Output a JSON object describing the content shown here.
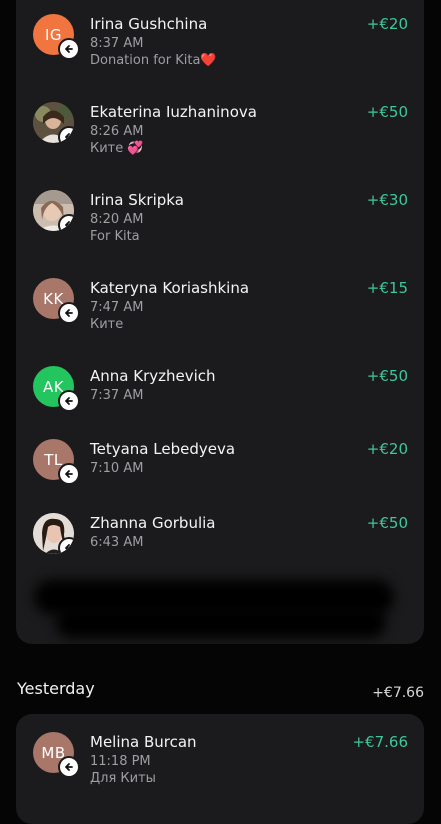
{
  "colors": {
    "background": "#050505",
    "card": "#1b1b1d",
    "income_amount": "#3dc79b",
    "secondary_text": "#9e9ea3"
  },
  "today": {
    "transactions": [
      {
        "name": "Irina Gushchina",
        "time": "8:37 AM",
        "note": "Donation for Kita❤️",
        "amount": "+€20",
        "avatar_initials": "IG",
        "avatar_color": "#f0753f",
        "avatar_type": "initials"
      },
      {
        "name": "Ekaterina Iuzhaninova",
        "time": "8:26 AM",
        "note": "Ките 💞",
        "amount": "+€50",
        "avatar_initials": "",
        "avatar_type": "photo"
      },
      {
        "name": "Irina Skripka",
        "time": "8:20 AM",
        "note": "For Kita",
        "amount": "+€30",
        "avatar_initials": "",
        "avatar_type": "photo"
      },
      {
        "name": "Kateryna Koriashkina",
        "time": "7:47 AM",
        "note": "Ките",
        "amount": "+€15",
        "avatar_initials": "KK",
        "avatar_color": "#a8776a",
        "avatar_type": "initials"
      },
      {
        "name": "Anna Kryzhevich",
        "time": "7:37 AM",
        "note": "",
        "amount": "+€50",
        "avatar_initials": "AK",
        "avatar_color": "#22c55e",
        "avatar_type": "initials"
      },
      {
        "name": "Tetyana Lebedyeva",
        "time": "7:10 AM",
        "note": "",
        "amount": "+€20",
        "avatar_initials": "TL",
        "avatar_color": "#a8776a",
        "avatar_type": "initials"
      },
      {
        "name": "Zhanna Gorbulia",
        "time": "6:43 AM",
        "note": "",
        "amount": "+€50",
        "avatar_initials": "",
        "avatar_type": "photo"
      }
    ]
  },
  "yesterday": {
    "title": "Yesterday",
    "total": "+€7.66",
    "transactions": [
      {
        "name": "Melina Burcan",
        "time": "11:18 PM",
        "note": "Для Киты",
        "amount": "+€7.66",
        "avatar_initials": "MB",
        "avatar_color": "#a8776a",
        "avatar_type": "initials"
      }
    ]
  },
  "icons": {
    "incoming_badge": "arrow-left-icon"
  }
}
